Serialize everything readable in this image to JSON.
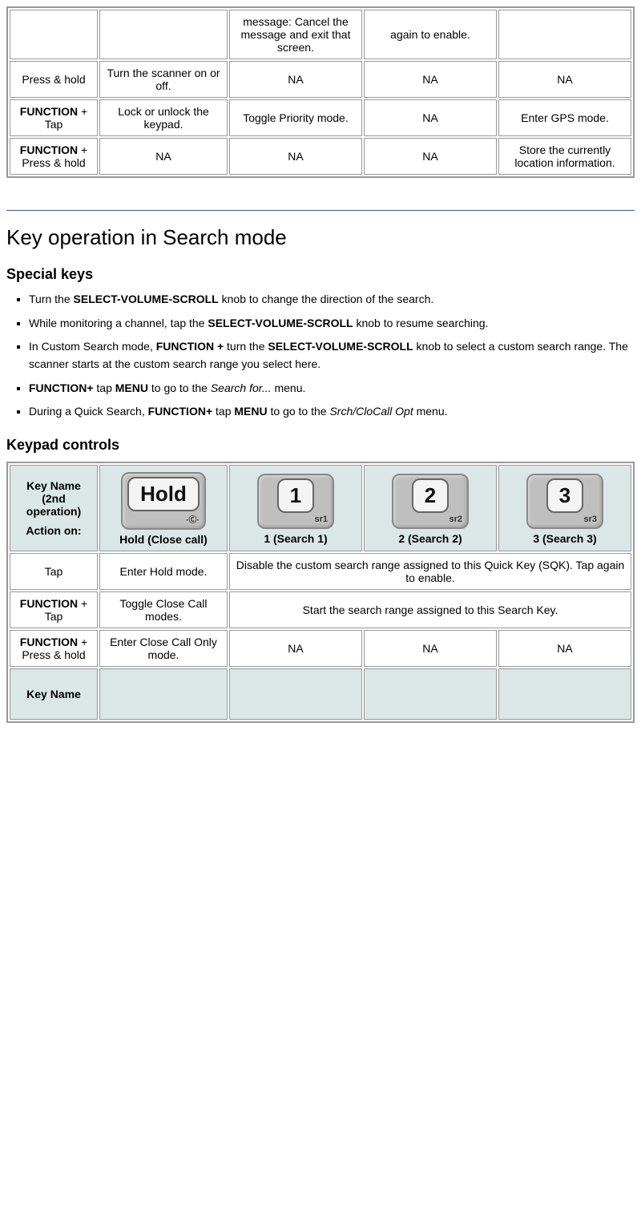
{
  "table1": {
    "row0": {
      "c3": "message: Cancel the message and exit that screen.",
      "c4": "again to enable."
    },
    "row1": {
      "c1": "Press & hold",
      "c2": "Turn the scanner on or off.",
      "c3": "NA",
      "c4": "NA",
      "c5": "NA"
    },
    "row2": {
      "c1a": "FUNCTION",
      "c1b": " + Tap",
      "c2": "Lock or unlock the keypad.",
      "c3": "Toggle Priority mode.",
      "c4": "NA",
      "c5": "Enter GPS mode."
    },
    "row3": {
      "c1a": "FUNCTION",
      "c1b": " + Press & hold",
      "c2": "NA",
      "c3": "NA",
      "c4": "NA",
      "c5": "Store the currently location information."
    }
  },
  "section_heading": "Key operation in Search mode",
  "sub_heading_1": "Special keys",
  "bullets": {
    "b1_pre": "Turn the ",
    "b1_bold": "SELECT-VOLUME-SCROLL",
    "b1_post": " knob to change the direction of the search.",
    "b2_pre": "While monitoring a channel, tap the ",
    "b2_bold": "SELECT-VOLUME-SCROLL",
    "b2_post": " knob to resume searching.",
    "b3_pre": "In Custom Search mode, ",
    "b3_bold1": "FUNCTION +",
    "b3_mid": " turn the ",
    "b3_bold2": "SELECT-VOLUME-SCROLL",
    "b3_post": " knob to select a custom search range. The scanner starts at the custom search range you select here.",
    "b4_bold1": "FUNCTION+",
    "b4_mid1": " tap ",
    "b4_bold2": "MENU",
    "b4_mid2": " to go to the ",
    "b4_em": "Search for...",
    "b4_post": " menu.",
    "b5_pre": "During a Quick Search, ",
    "b5_bold1": "FUNCTION+",
    "b5_mid1": " tap ",
    "b5_bold2": "MENU",
    "b5_mid2": " to go to the ",
    "b5_em": "Srch/CloCall Opt",
    "b5_post": " menu."
  },
  "sub_heading_2": "Keypad controls",
  "table2": {
    "header": {
      "left_a": "Key Name (2nd operation)",
      "left_b": "Action on:",
      "hold_main": "Hold",
      "hold_sub": "·Ⓒ·",
      "hold_label": "Hold (Close call)",
      "k1_main": "1",
      "k1_sub": "sr1",
      "k1_label": "1 (Search 1)",
      "k2_main": "2",
      "k2_sub": "sr2",
      "k2_label": "2 (Search 2)",
      "k3_main": "3",
      "k3_sub": "sr3",
      "k3_label": "3 (Search 3)"
    },
    "row_tap": {
      "c1": "Tap",
      "c2": "Enter Hold mode.",
      "c345": "Disable the custom search range assigned to this Quick Key (SQK). Tap again to enable."
    },
    "row_ftap": {
      "c1a": "FUNCTION",
      "c1b": " + Tap",
      "c2": "Toggle Close Call modes.",
      "c345": "Start the search range assigned to this Search Key."
    },
    "row_fhold": {
      "c1a": "FUNCTION",
      "c1b": " + Press & hold",
      "c2": "Enter Close Call Only mode.",
      "c3": "NA",
      "c4": "NA",
      "c5": "NA"
    },
    "row_next_header": {
      "left": "Key Name"
    }
  }
}
